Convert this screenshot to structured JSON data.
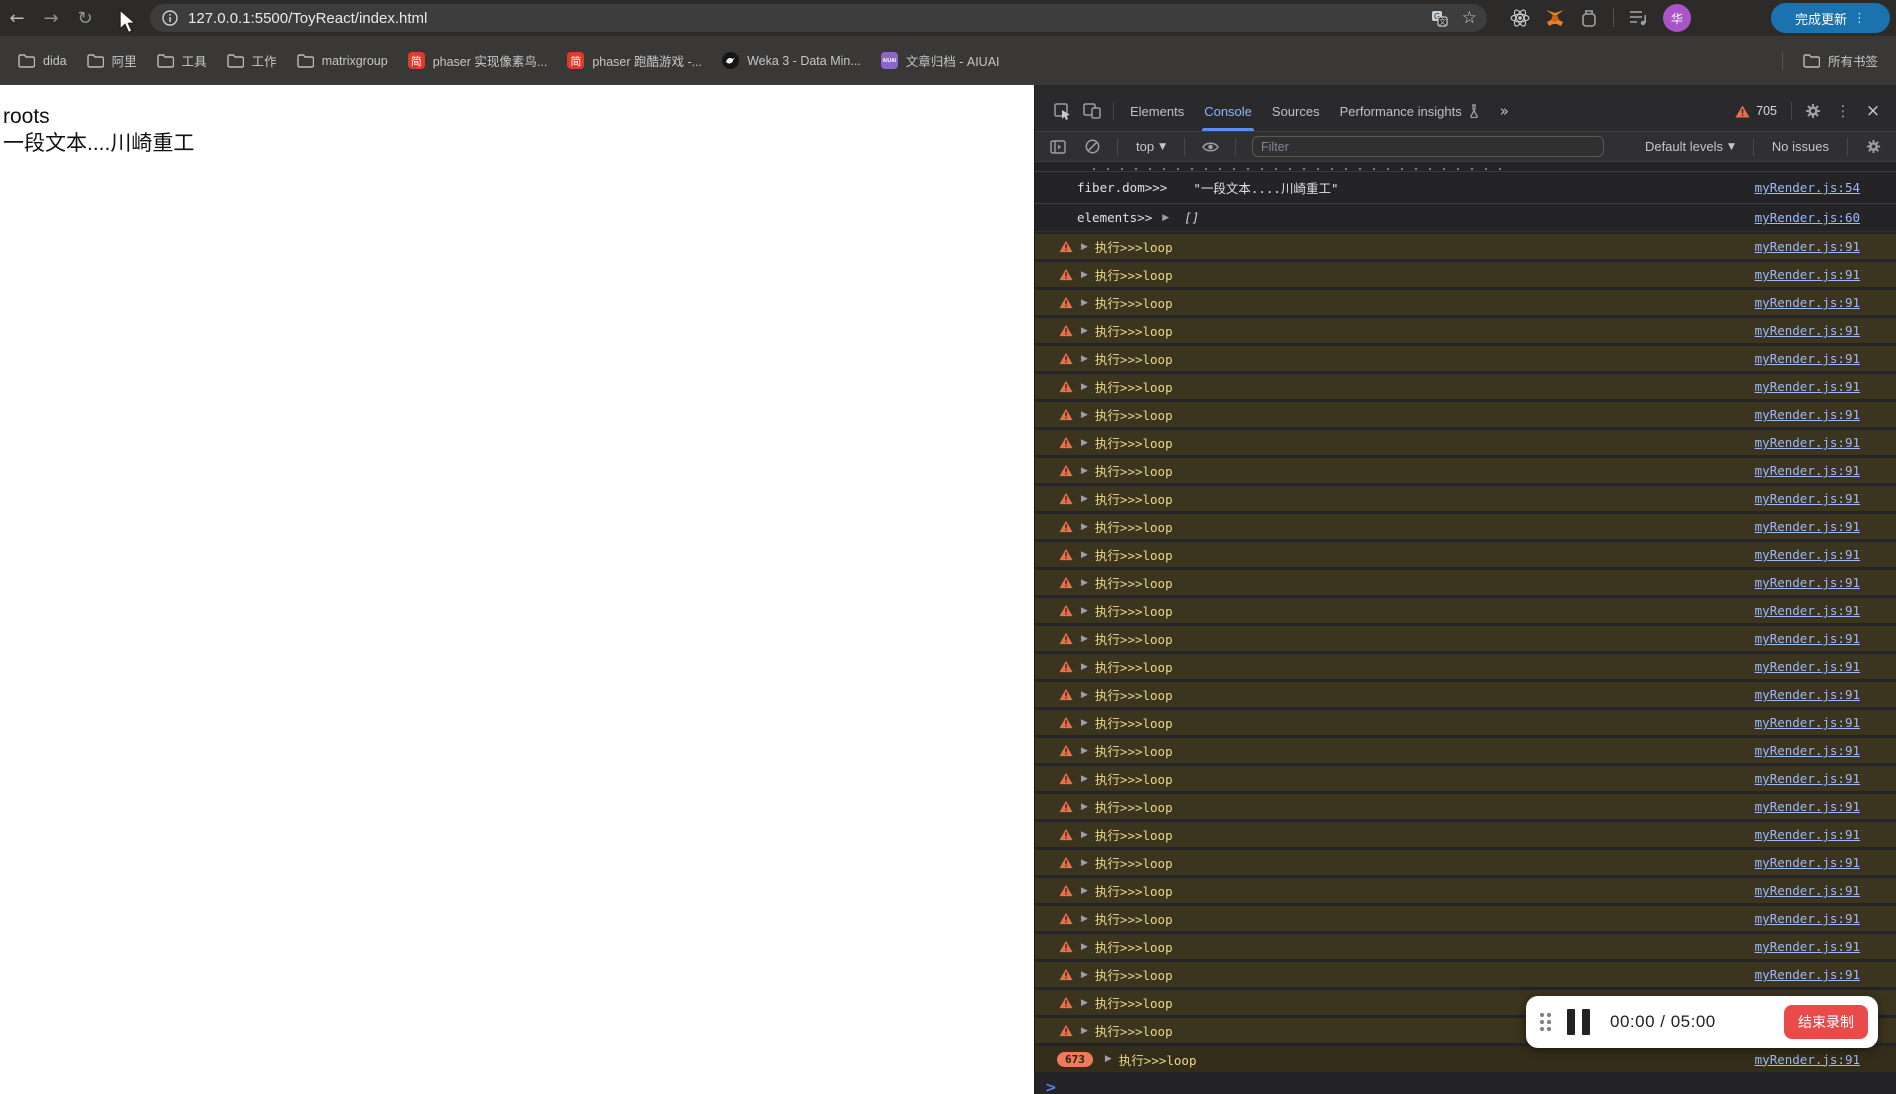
{
  "browser": {
    "url": "127.0.0.1:5500/ToyReact/index.html",
    "update_button": "完成更新",
    "avatar_initial": "华",
    "bookmarks": [
      {
        "label": "dida"
      },
      {
        "label": "阿里"
      },
      {
        "label": "工具"
      },
      {
        "label": "工作"
      },
      {
        "label": "matrixgroup"
      },
      {
        "label": "phaser 实现像素鸟...",
        "badge": "简"
      },
      {
        "label": "phaser 跑酷游戏 -...",
        "badge": "简"
      },
      {
        "label": "Weka 3 - Data Min..."
      },
      {
        "label": "文章归档 - AIUAI",
        "badge": "AIUAI"
      }
    ],
    "all_bookmarks": "所有书签"
  },
  "page": {
    "line1": "roots",
    "line2": "一段文本....川崎重工"
  },
  "devtools": {
    "tabs": {
      "elements": "Elements",
      "console": "Console",
      "sources": "Sources",
      "performance": "Performance insights"
    },
    "warning_count": "705",
    "toolbar": {
      "context": "top",
      "filter_placeholder": "Filter",
      "levels": "Default levels",
      "issues": "No issues"
    },
    "console": {
      "fiber": {
        "label": "fiber.dom>>>",
        "value": "\"一段文本....川崎重工\"",
        "link": "myRender.js:54"
      },
      "elements": {
        "label": "elements>>",
        "value": "[]",
        "link": "myRender.js:60"
      },
      "warning": {
        "label": "执行>>>loop",
        "link": "myRender.js:91",
        "repeat_visible": 29
      },
      "collapsed": {
        "badge": "673",
        "label": "执行>>>loop",
        "link": "myRender.js:91"
      },
      "prompt": ">"
    }
  },
  "recorder": {
    "time": "00:00 / 05:00",
    "stop_label": "结束录制"
  },
  "colors": {
    "accent_blue": "#8ab4f8",
    "warning_bg": "#3b341e",
    "warning_text": "#e9d88a",
    "warning_icon": "#e8704e",
    "link": "#9db8f5",
    "record_red": "#e94b4b",
    "update_pill": "#1a72ae"
  }
}
